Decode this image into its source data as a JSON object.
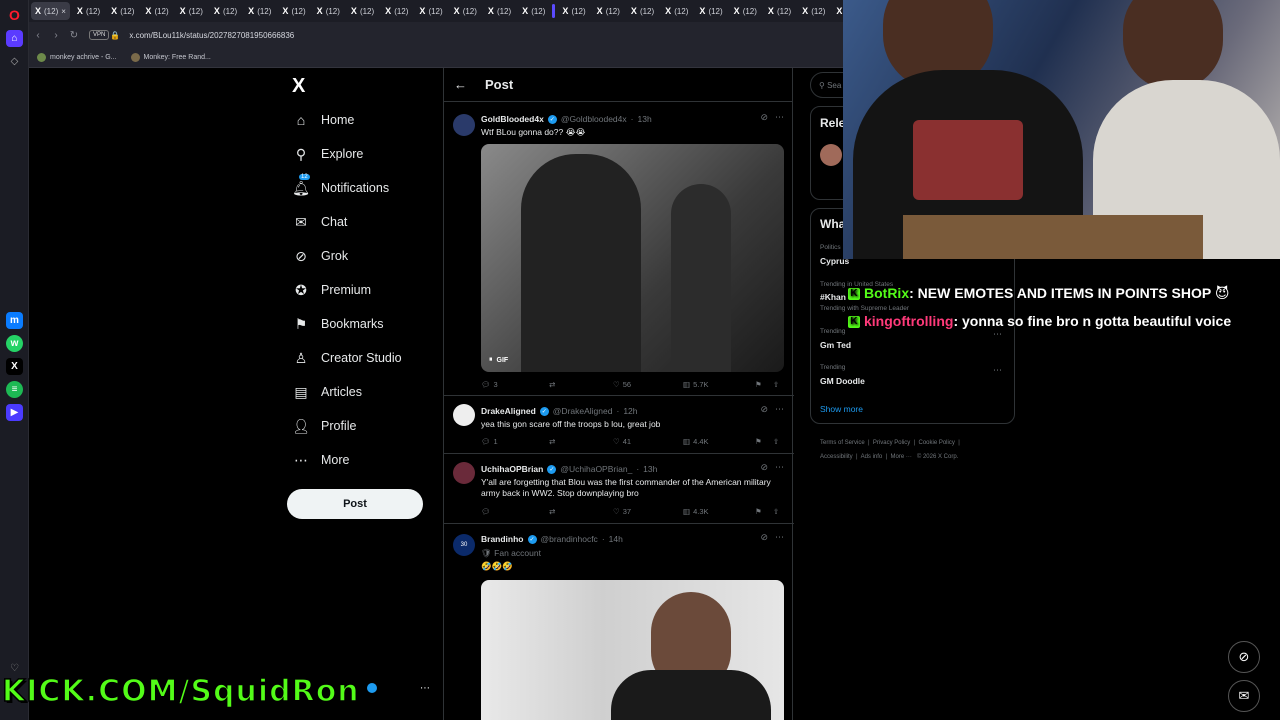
{
  "browser": {
    "tabs": [
      "(12)",
      "(12)",
      "(12)",
      "(12)",
      "(12)",
      "(12)",
      "(12)",
      "(12)",
      "(12)",
      "(12)",
      "(12)",
      "(12)",
      "(12)",
      "(12)",
      "(12)",
      "(12)",
      "(12)",
      "(12)",
      "(12)",
      "(12)",
      "(12)",
      "(12)",
      "(12)",
      "(12)"
    ],
    "url": "x.com/BLou11k/status/2027827081950666836",
    "vpn_label": "VPN",
    "bookmarks": [
      "monkey achrive - G...",
      "Monkey: Free Rand..."
    ]
  },
  "nav": {
    "logo": "X",
    "items": [
      "Home",
      "Explore",
      "Notifications",
      "Chat",
      "Grok",
      "Premium",
      "Bookmarks",
      "Creator Studio",
      "Articles",
      "Profile",
      "More"
    ],
    "notif_badge": "12",
    "post_label": "Post"
  },
  "main": {
    "title": "Post",
    "tweets": [
      {
        "name": "GoldBlooded4x",
        "handle": "@Goldblooded4x",
        "time": "13h",
        "text": "Wtf BLou gonna do?? 😭😭",
        "replies": "3",
        "likes": "56",
        "views": "5.7K",
        "media_tag": "GIF"
      },
      {
        "name": "DrakeAligned",
        "handle": "@DrakeAligned",
        "time": "12h",
        "text": "yea this gon scare off the troops b lou, great job",
        "replies": "1",
        "likes": "41",
        "views": "4.4K"
      },
      {
        "name": "UchihaOPBrian",
        "handle": "@UchihaOPBrian_",
        "time": "13h",
        "text": "Y'all are forgetting that Blou was the first commander of the American military army back in WW2. Stop downplaying bro",
        "replies": "",
        "likes": "37",
        "views": "4.3K"
      },
      {
        "name": "Brandinho",
        "handle": "@brandinhocfc",
        "time": "14h",
        "label": "Fan account",
        "text": "🤣🤣🤣"
      }
    ]
  },
  "right": {
    "search_placeholder": "Sea",
    "relevant_title": "Rele",
    "whats_title": "Wha",
    "trends": [
      {
        "label": "Politics",
        "name": "Cyprus"
      },
      {
        "label": "Trending in United States",
        "name": "#Khan"
      },
      {
        "label": "Trending with Supreme Leader",
        "name": ""
      },
      {
        "label": "Trending",
        "name": "Gm Ted"
      },
      {
        "label": "Trending",
        "name": "GM Doodle"
      }
    ],
    "show_more": "Show more",
    "footer": [
      "Terms of Service",
      "Privacy Policy",
      "Cookie Policy",
      "Accessibility",
      "Ads info",
      "More ···",
      "© 2026 X Corp."
    ]
  },
  "overlay": {
    "chat": [
      {
        "user": "BotRix",
        "message": ": NEW EMOTES AND ITEMS IN POINTS SHOP 😈"
      },
      {
        "user": "kingoftrolling",
        "message": ": yonna so fine bro n gotta beautiful voice"
      }
    ],
    "banner": "KICK.COM/SquidRon"
  },
  "colors": {
    "accent": "#1d9bf0",
    "kick": "#53fc18",
    "bg": "#000000",
    "border": "#2f3336"
  }
}
